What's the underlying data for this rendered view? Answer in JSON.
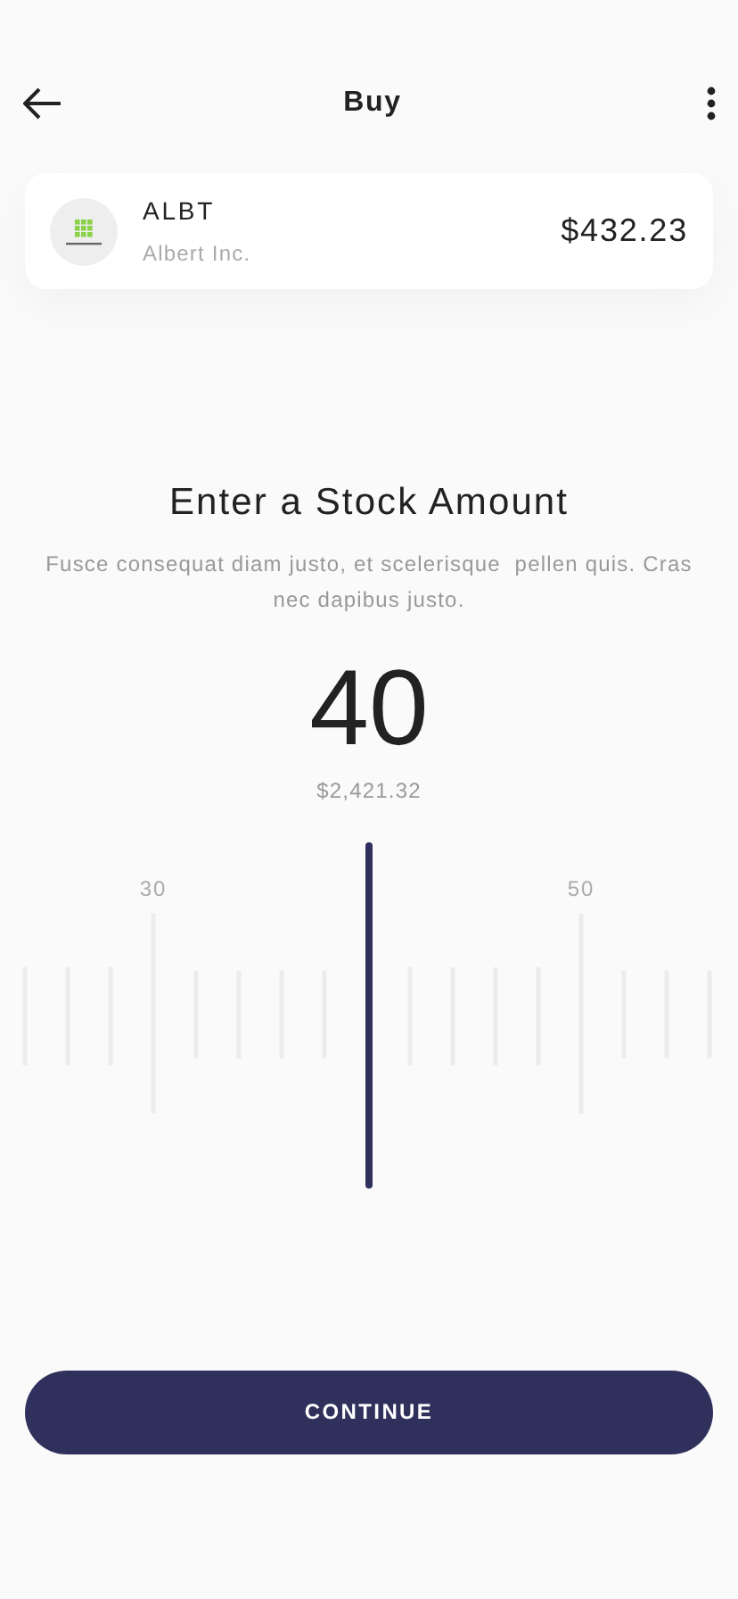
{
  "header": {
    "title": "Buy"
  },
  "stock": {
    "ticker": "ALBT",
    "name": "Albert Inc.",
    "price": "$432.23"
  },
  "prompt": {
    "title": "Enter a Stock Amount",
    "description": "Fusce consequat diam justo, et scelerisque  pellen quis. Cras nec dapibus justo."
  },
  "amount": {
    "value": "40",
    "total": "$2,421.32"
  },
  "ruler": {
    "labels": [
      "30",
      "50"
    ]
  },
  "continue_button": {
    "label": "CONTINUE"
  }
}
